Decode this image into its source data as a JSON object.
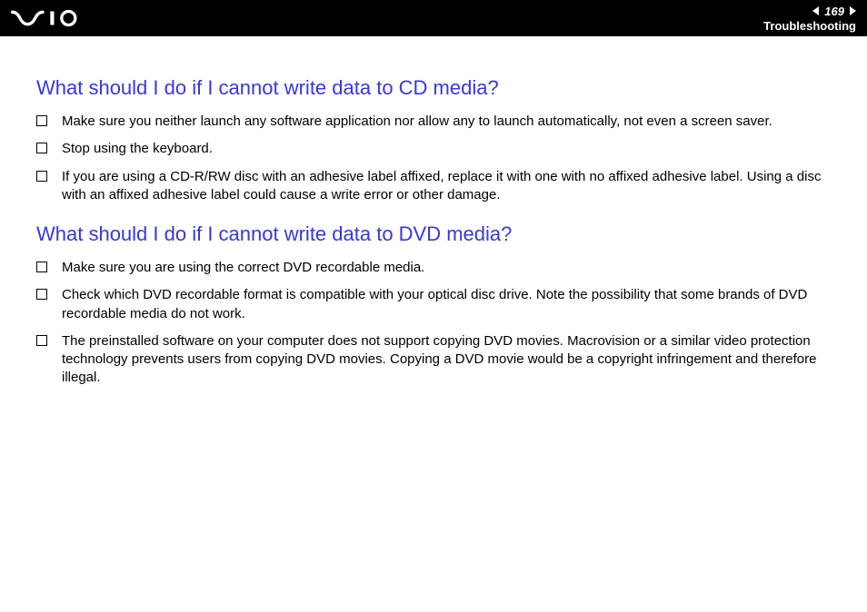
{
  "header": {
    "page_number": "169",
    "section_label": "Troubleshooting"
  },
  "sections": [
    {
      "heading": "What should I do if I cannot write data to CD media?",
      "items": [
        "Make sure you neither launch any software application nor allow any to launch automatically, not even a screen saver.",
        "Stop using the keyboard.",
        "If you are using a CD-R/RW disc with an adhesive label affixed, replace it with one with no affixed adhesive label. Using a disc with an affixed adhesive label could cause a write error or other damage."
      ]
    },
    {
      "heading": "What should I do if I cannot write data to DVD media?",
      "items": [
        "Make sure you are using the correct DVD recordable media.",
        "Check which DVD recordable format is compatible with your optical disc drive. Note the possibility that some brands of DVD recordable media do not work.",
        "The preinstalled software on your computer does not support copying DVD movies. Macrovision or a similar video protection technology prevents users from copying DVD movies. Copying a DVD movie would be a copyright infringement and therefore illegal."
      ]
    }
  ]
}
